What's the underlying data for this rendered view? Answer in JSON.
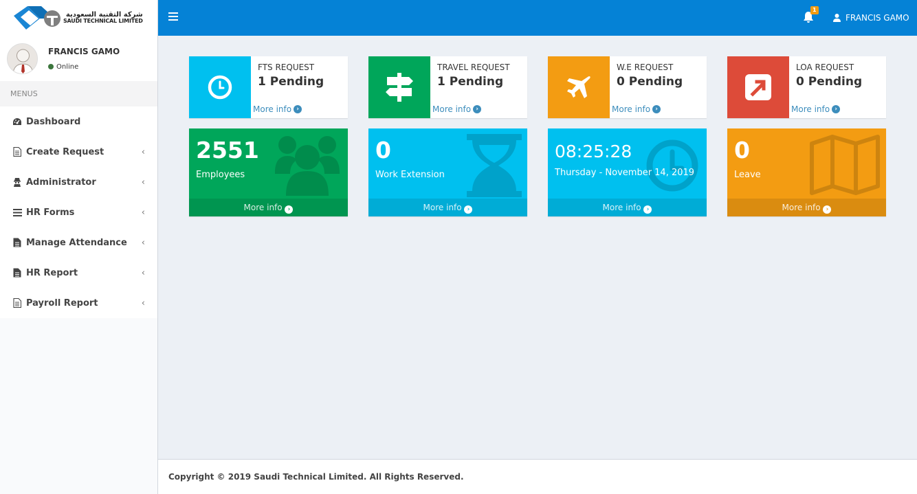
{
  "brand": {
    "arabic": "شركة التقنية السعودية",
    "english": "SAUDI TECHNICAL LIMITED"
  },
  "user": {
    "name": "FRANCIS GAMO",
    "status": "Online"
  },
  "menu": {
    "header": "MENUS",
    "items": [
      {
        "label": "Dashboard",
        "icon": "dashboard-icon",
        "has_sub": false
      },
      {
        "label": "Create Request",
        "icon": "file-icon",
        "has_sub": true
      },
      {
        "label": "Administrator",
        "icon": "user-secret-icon",
        "has_sub": true
      },
      {
        "label": "HR Forms",
        "icon": "list-icon",
        "has_sub": true
      },
      {
        "label": "Manage Attendance",
        "icon": "file-text-icon",
        "has_sub": true
      },
      {
        "label": "HR Report",
        "icon": "file-text-icon",
        "has_sub": true
      },
      {
        "label": "Payroll Report",
        "icon": "file-icon",
        "has_sub": true
      }
    ]
  },
  "topbar": {
    "notification_count": "1",
    "user_name": "FRANCIS GAMO"
  },
  "info_boxes": [
    {
      "title": "FTS REQUEST",
      "value": "1 Pending",
      "link": "More info",
      "color": "#00c0ef",
      "icon": "clock-icon"
    },
    {
      "title": "TRAVEL REQUEST",
      "value": "1 Pending",
      "link": "More info",
      "color": "#00a65a",
      "icon": "signpost-icon"
    },
    {
      "title": "W.E REQUEST",
      "value": "0 Pending",
      "link": "More info",
      "color": "#f39c12",
      "icon": "plane-icon"
    },
    {
      "title": "LOA REQUEST",
      "value": "0 Pending",
      "link": "More info",
      "color": "#dd4b39",
      "icon": "external-link-icon"
    }
  ],
  "small_boxes": [
    {
      "value": "2551",
      "label": "Employees",
      "link": "More info",
      "color": "#00a65a",
      "icon": "users-icon"
    },
    {
      "value": "0",
      "label": "Work Extension",
      "link": "More info",
      "color": "#00c0ef",
      "icon": "hourglass-icon"
    },
    {
      "value": "08:25:28",
      "label": "Thursday - November 14, 2019",
      "link": "More info",
      "color": "#00c0ef",
      "icon": "clock-icon"
    },
    {
      "value": "0",
      "label": "Leave",
      "link": "More info",
      "color": "#f39c12",
      "icon": "map-icon"
    }
  ],
  "footer": {
    "text": "Copyright © 2019 Saudi Technical Limited. All Rights Reserved."
  }
}
